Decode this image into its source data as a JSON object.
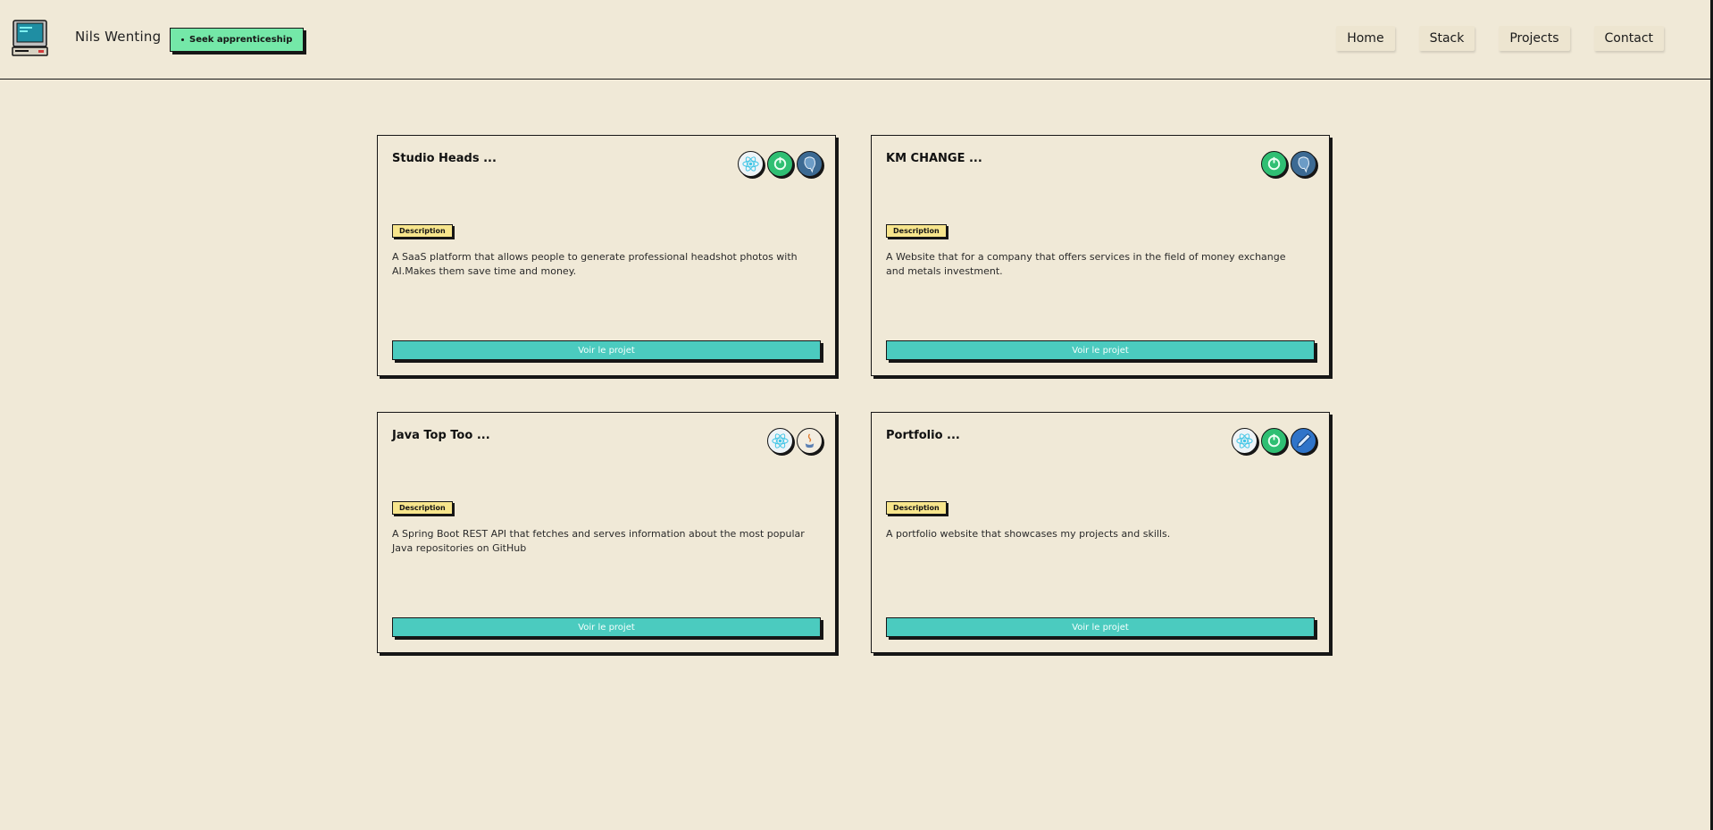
{
  "header": {
    "brand": "Nils Wenting",
    "status_button": "Seek apprenticeship",
    "nav": [
      {
        "label": "Home"
      },
      {
        "label": "Stack"
      },
      {
        "label": "Projects"
      },
      {
        "label": "Contact"
      }
    ]
  },
  "projects": [
    {
      "title": "Studio Heads ...",
      "badge": "Description",
      "description": "A SaaS platform that allows people to generate professional headshot photos with AI.Makes them save time and money.",
      "button": "Voir le projet",
      "tech_icons": [
        "react-icon",
        "nodejs-icon",
        "postgresql-icon"
      ]
    },
    {
      "title": "KM CHANGE ...",
      "badge": "Description",
      "description": "A Website that for a company that offers services in the field of money exchange and metals investment.",
      "button": "Voir le projet",
      "tech_icons": [
        "nodejs-icon",
        "postgresql-icon"
      ]
    },
    {
      "title": "Java Top Too ...",
      "badge": "Description",
      "description": "A Spring Boot REST API that fetches and serves information about the most popular Java repositories on GitHub",
      "button": "Voir le projet",
      "tech_icons": [
        "react-icon",
        "java-icon"
      ]
    },
    {
      "title": "Portfolio ...",
      "badge": "Description",
      "description": "A portfolio website that showcases my projects and skills.",
      "button": "Voir le projet",
      "tech_icons": [
        "react-icon",
        "nodejs-icon",
        "pen-icon"
      ]
    }
  ],
  "colors": {
    "background": "#f0e9d7",
    "accent_button": "#4bcbbf",
    "status_green": "#74e8a8",
    "badge_yellow": "#f7e58c",
    "border": "#161616"
  }
}
